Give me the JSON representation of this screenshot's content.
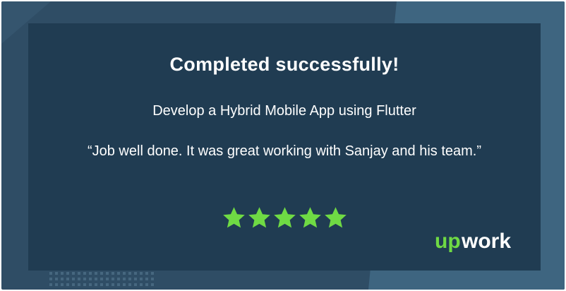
{
  "card": {
    "title": "Completed successfully!",
    "project": "Develop a Hybrid Mobile App using Flutter",
    "quote": "“Job well done. It was great working with Sanjay and his team.”",
    "rating": {
      "value": 5,
      "max": 5
    },
    "logo_text": "upwork"
  },
  "colors": {
    "outer": "#2f4d65",
    "panel": "#203c52",
    "accent": "#3e6580",
    "star": "#6fda44",
    "text": "#ffffff"
  },
  "icons": [
    "star-icon",
    "upwork-logo"
  ]
}
